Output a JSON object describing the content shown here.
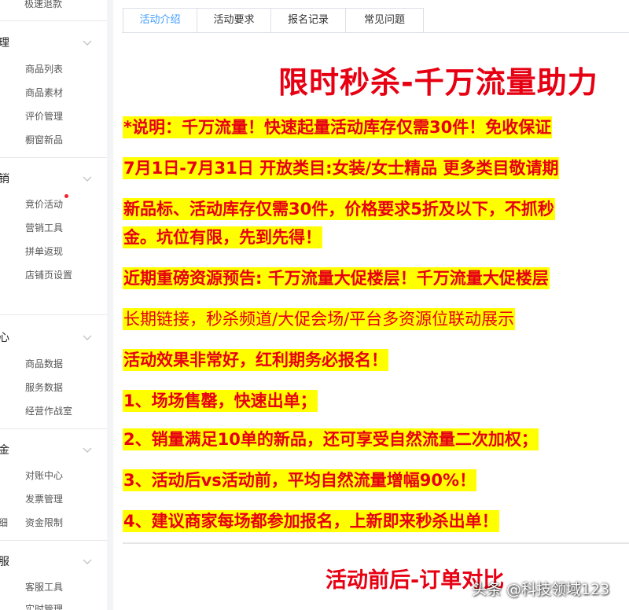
{
  "sidebar": {
    "top_item": "极速退款",
    "groups": [
      {
        "title": "理",
        "items": [
          "商品列表",
          "商品素材",
          "评价管理",
          "橱窗新品"
        ]
      },
      {
        "title": "销",
        "items": [
          "竞价活动",
          "营销工具",
          "拼单返现",
          "店铺页设置"
        ]
      },
      {
        "title": "心",
        "items": [
          "商品数据",
          "服务数据",
          "经营作战室"
        ]
      },
      {
        "title": "金",
        "items": [
          "对账中心",
          "发票管理",
          "资金限制"
        ],
        "side_label": "细"
      },
      {
        "title": "服",
        "items": [
          "客服工具",
          "实时管理"
        ]
      }
    ]
  },
  "tabs": [
    {
      "label": "活动介绍",
      "active": true
    },
    {
      "label": "活动要求",
      "active": false
    },
    {
      "label": "报名记录",
      "active": false
    },
    {
      "label": "常见问题",
      "active": false
    }
  ],
  "content": {
    "title": "限时秒杀-千万流量助力",
    "lines": [
      "*说明：千万流量！快速起量活动库存仅需30件！免收保证",
      "7月1日-7月31日 开放类目:女装/女士精品 更多类目敬请期",
      "新品标、活动库存仅需30件，价格要求5折及以下，不抓秒",
      "金。坑位有限，先到先得！",
      "近期重磅资源预告: 千万流量大促楼层！千万流量大促楼层",
      "长期链接，秒杀频道/大促会场/平台多资源位联动展示",
      "活动效果非常好，红利期务必报名！",
      "1、场场售罄，快速出单；",
      "2、销量满足10单的新品，还可享受自然流量二次加权；",
      "3、活动后vs活动前，平均自然流量增幅90%！",
      "4、建议商家每场都参加报名，上新即来秒杀出单！"
    ],
    "subtitle": "活动前后-订单对比"
  },
  "watermark": "头条 @科技领域123",
  "colors": {
    "accent": "#409eff",
    "highlight": "#ffff00",
    "promo_red": "#e60012",
    "badge_red": "#f5222d"
  }
}
